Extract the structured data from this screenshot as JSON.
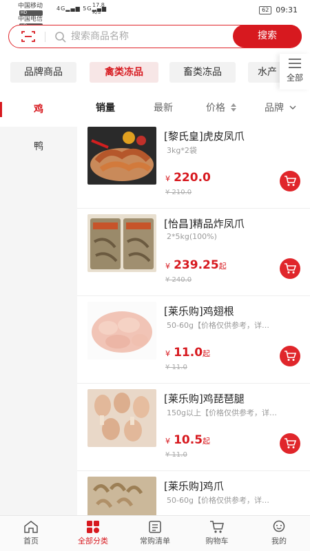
{
  "status_bar": {
    "carrier1": "中国移动",
    "carrier2": "中国电信",
    "hd": "HD",
    "signal_a": "4G",
    "signal_b": "5G",
    "speed_value": "17.8",
    "speed_unit": "K/s",
    "battery": "62",
    "time": "09:31"
  },
  "search": {
    "placeholder": "搜索商品名称",
    "button_label": "搜索"
  },
  "categories": [
    {
      "label": "品牌商品",
      "active": false
    },
    {
      "label": "禽类冻品",
      "active": true
    },
    {
      "label": "畜类冻品",
      "active": false
    },
    {
      "label": "水产",
      "active": false
    }
  ],
  "all_categories_label": "全部",
  "sidebar": [
    {
      "label": "鸡",
      "active": true
    },
    {
      "label": "鸭",
      "active": false
    }
  ],
  "sort_options": {
    "sales": "销量",
    "newest": "最新",
    "price": "价格",
    "brand": "品牌"
  },
  "products": [
    {
      "name": "[黎氏皇]虎皮凤爪",
      "spec": "3kg*2袋",
      "price": "220.0",
      "price_suffix": "",
      "original_price": "¥ 210.0"
    },
    {
      "name": "[怡昌]精品炸凤爪",
      "spec": "2*5kg(100%)",
      "price": "239.25",
      "price_suffix": "起",
      "original_price": "¥ 240.0"
    },
    {
      "name": "[莱乐购]鸡翅根",
      "spec": "50-60g【价格仅供参考，详…",
      "price": "11.0",
      "price_suffix": "起",
      "original_price": "¥ 11.0"
    },
    {
      "name": "[莱乐购]鸡琵琶腿",
      "spec": "150g以上【价格仅供参考，详…",
      "price": "10.5",
      "price_suffix": "起",
      "original_price": "¥ 11.0"
    },
    {
      "name": "[莱乐购]鸡爪",
      "spec": "50-60g【价格仅供参考，详…",
      "price": "",
      "price_suffix": "",
      "original_price": ""
    }
  ],
  "currency_symbol": "¥",
  "bottom_nav": [
    {
      "label": "首页",
      "icon": "home-icon",
      "active": false
    },
    {
      "label": "全部分类",
      "icon": "category-icon",
      "active": true
    },
    {
      "label": "常购清单",
      "icon": "list-icon",
      "active": false
    },
    {
      "label": "购物车",
      "icon": "cart-icon",
      "active": false
    },
    {
      "label": "我的",
      "icon": "profile-icon",
      "active": false
    }
  ],
  "colors": {
    "accent": "#d7191f"
  }
}
